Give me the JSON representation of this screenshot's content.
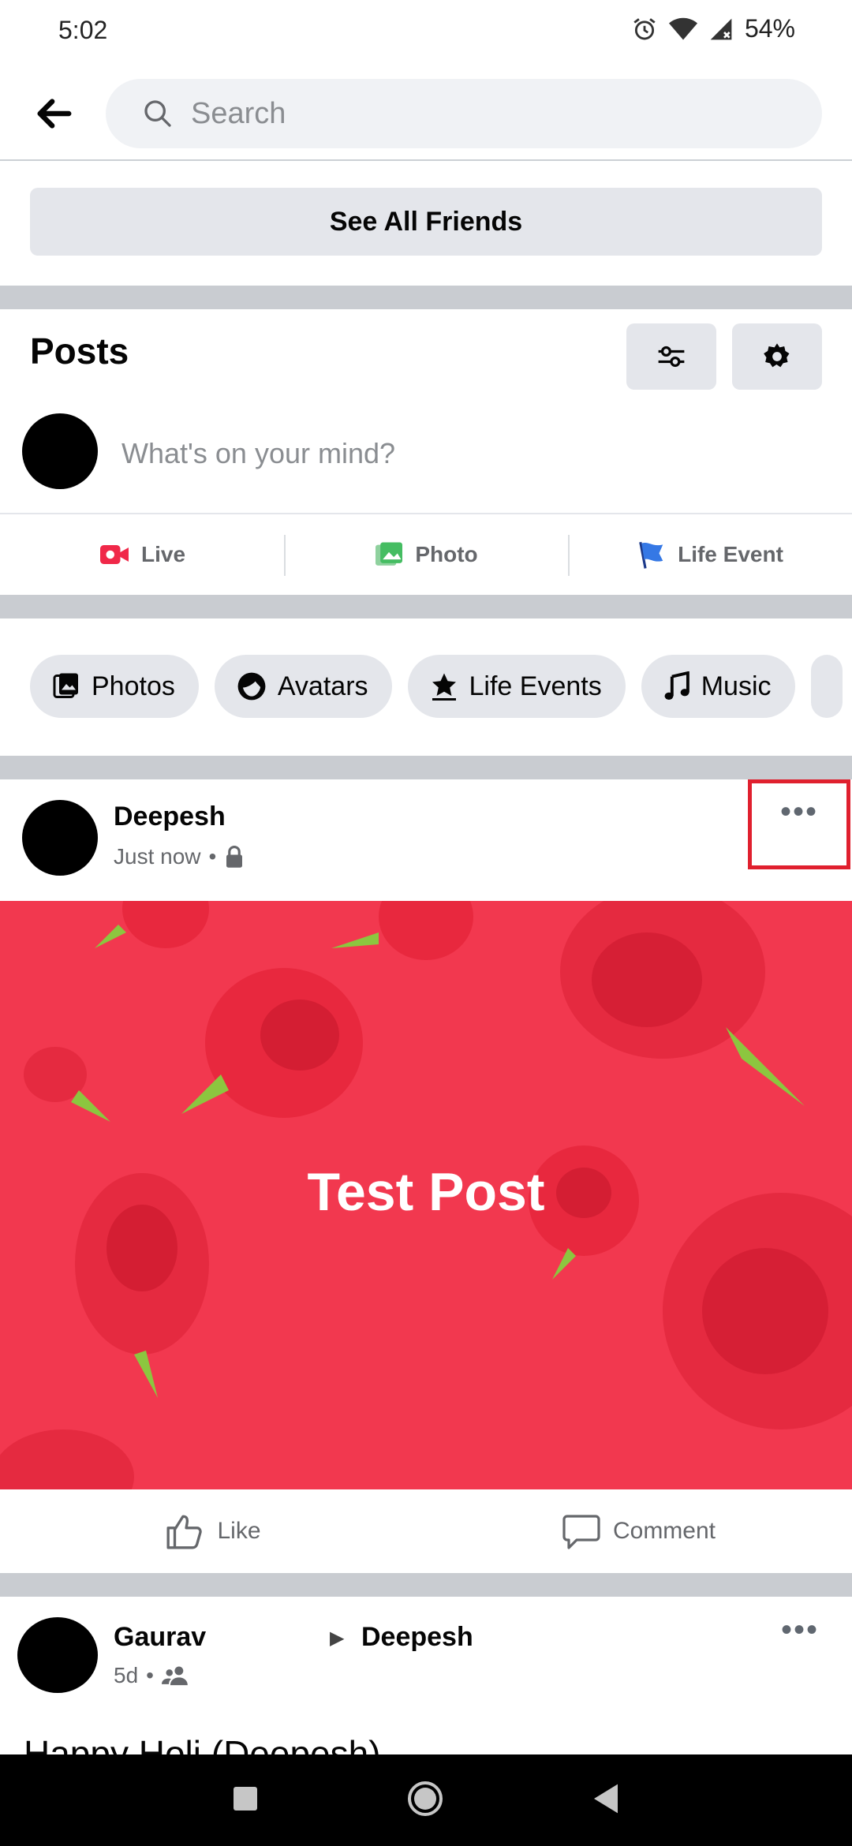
{
  "status_bar": {
    "time": "5:02",
    "battery": "54%"
  },
  "search": {
    "placeholder": "Search"
  },
  "friends": {
    "see_all_label": "See All Friends"
  },
  "posts_section": {
    "title": "Posts",
    "composer_placeholder": "What's on your mind?",
    "actions": [
      {
        "label": "Live",
        "icon": "live-video-icon",
        "color": "#f02849"
      },
      {
        "label": "Photo",
        "icon": "photo-icon",
        "color": "#45bd62"
      },
      {
        "label": "Life Event",
        "icon": "flag-icon",
        "color": "#3578e5"
      }
    ]
  },
  "chips": [
    {
      "label": "Photos",
      "icon": "photos-icon"
    },
    {
      "label": "Avatars",
      "icon": "avatar-icon"
    },
    {
      "label": "Life Events",
      "icon": "star-icon"
    },
    {
      "label": "Music",
      "icon": "music-note-icon"
    }
  ],
  "post": {
    "author": "Deepesh",
    "time": "Just now",
    "privacy_icon": "lock-icon",
    "image_text": "Test Post",
    "image_bg": "#f2384f",
    "like_label": "Like",
    "comment_label": "Comment"
  },
  "post2": {
    "author": "Gaurav",
    "target": "Deepesh",
    "time": "5d",
    "privacy_icon": "friends-icon",
    "snippet": "Happy Holi (Deepesh) …"
  }
}
